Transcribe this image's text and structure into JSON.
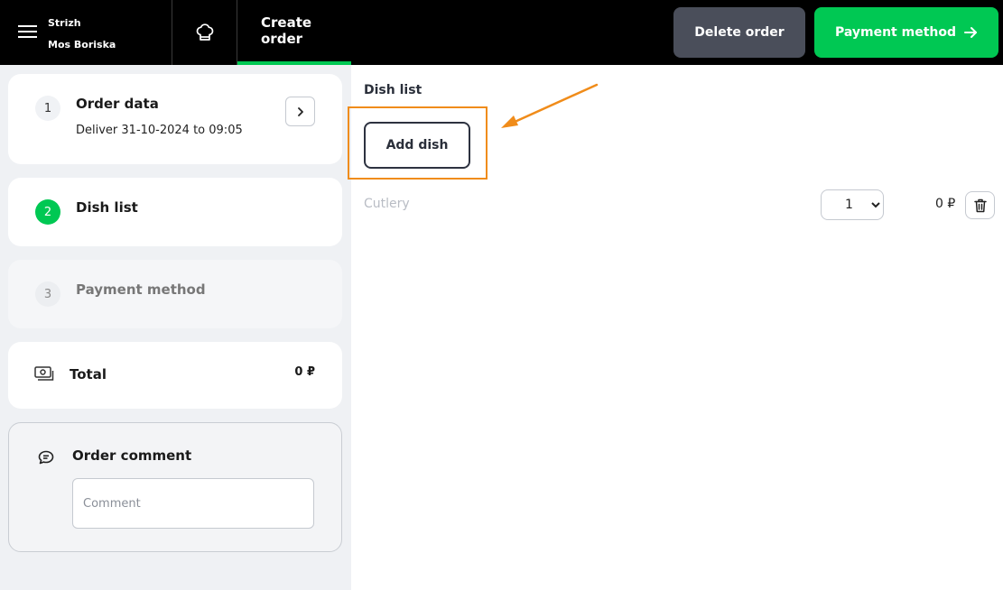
{
  "header": {
    "user_name": "Strizh",
    "user_location": "Mos Boriska",
    "create_tab_line1": "Create",
    "create_tab_line2": "order",
    "delete_label": "Delete order",
    "payment_label": "Payment method"
  },
  "steps": [
    {
      "number": "1",
      "title": "Order data",
      "subtitle": "Deliver 31-10-2024 to 09:05"
    },
    {
      "number": "2",
      "title": "Dish list"
    },
    {
      "number": "3",
      "title": "Payment method"
    }
  ],
  "total": {
    "label": "Total",
    "value": "0 ₽"
  },
  "comment": {
    "title": "Order comment",
    "placeholder": "Comment",
    "value": ""
  },
  "dish_list": {
    "title": "Dish list",
    "add_label": "Add dish",
    "items": [
      {
        "name": "Cutlery",
        "quantity": "1",
        "price": "0 ₽"
      }
    ]
  },
  "icons": {
    "menu": "hamburger-menu-icon",
    "chef": "chef-hat-icon",
    "arrow": "arrow-right-icon",
    "chevron": "chevron-right-icon",
    "money": "banknote-icon",
    "comment": "chat-bubble-icon",
    "trash": "trash-icon"
  },
  "colors": {
    "accent_green": "#00c853",
    "highlight_orange": "#f08c1a",
    "header_bg": "#000000",
    "delete_bg": "#4a4e5a"
  }
}
